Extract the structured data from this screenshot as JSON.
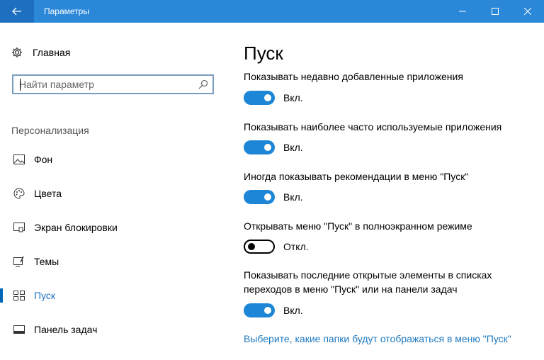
{
  "window": {
    "title": "Параметры"
  },
  "sidebar": {
    "home_label": "Главная",
    "search_placeholder": "Найти параметр",
    "section_header": "Персонализация",
    "items": [
      {
        "label": "Фон",
        "icon": "image-icon"
      },
      {
        "label": "Цвета",
        "icon": "palette-icon"
      },
      {
        "label": "Экран блокировки",
        "icon": "lock-screen-icon"
      },
      {
        "label": "Темы",
        "icon": "themes-icon"
      },
      {
        "label": "Пуск",
        "icon": "start-icon",
        "active": true
      },
      {
        "label": "Панель задач",
        "icon": "taskbar-icon"
      }
    ]
  },
  "main": {
    "title": "Пуск",
    "options": [
      {
        "label": "Показывать недавно добавленные приложения",
        "state": "Вкл.",
        "on": true
      },
      {
        "label": "Показывать наиболее часто используемые приложения",
        "state": "Вкл.",
        "on": true
      },
      {
        "label": "Иногда показывать рекомендации в меню \"Пуск\"",
        "state": "Вкл.",
        "on": true
      },
      {
        "label": "Открывать меню \"Пуск\" в полноэкранном режиме",
        "state": "Откл.",
        "on": false
      },
      {
        "label": "Показывать последние открытые элементы в списках переходов в меню \"Пуск\" или на панели задач",
        "state": "Вкл.",
        "on": true
      }
    ],
    "link": "Выберите, какие папки будут отображаться в меню \"Пуск\""
  },
  "colors": {
    "titlebar": "#2b88d8",
    "accent": "#1e86d6",
    "link": "#1e7ac0"
  }
}
